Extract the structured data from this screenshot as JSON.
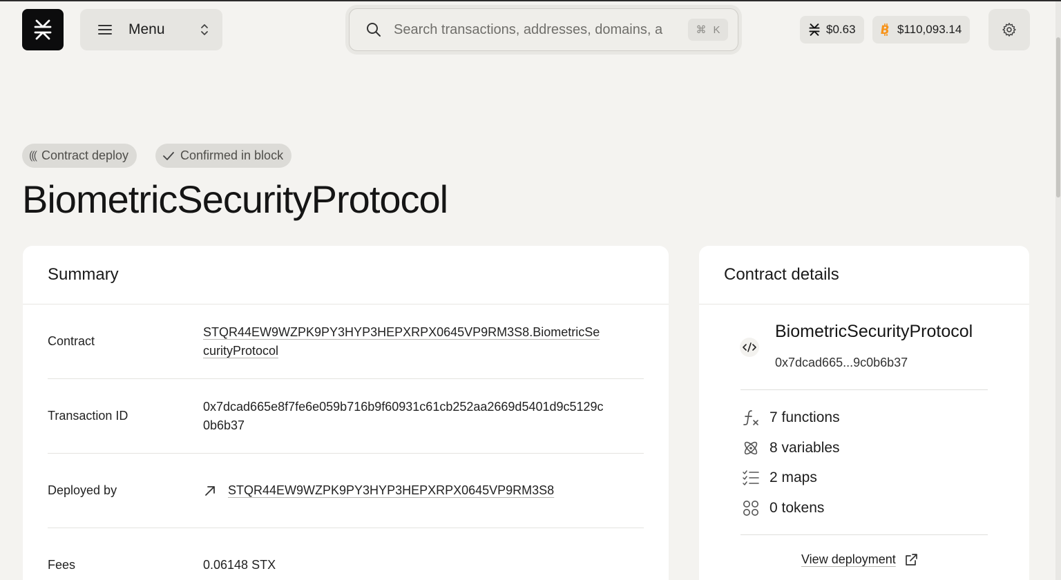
{
  "header": {
    "menu_label": "Menu",
    "search": {
      "placeholder": "Search transactions, addresses, domains, a",
      "shortcut_symbol": "⌘",
      "shortcut_key": "K"
    },
    "prices": {
      "stx": "$0.63",
      "btc": "$110,093.14"
    },
    "icons": [
      "stacks-logo-icon",
      "hamburger-icon",
      "chevron-updown-icon",
      "search-icon",
      "bitcoin-icon",
      "gear-icon"
    ]
  },
  "badges": {
    "type": "Contract deploy",
    "status": "Confirmed in block"
  },
  "page_title": "BiometricSecurityProtocol",
  "summary": {
    "title": "Summary",
    "rows": [
      {
        "key": "Contract",
        "value": "STQR44EW9WZPK9PY3HYP3HEPXRPX0645VP9RM3S8.BiometricSecurityProtocol"
      },
      {
        "key": "Transaction ID",
        "value": "0x7dcad665e8f7fe6e059b716b9f60931c61cb252aa2669d5401d9c5129c0b6b37"
      },
      {
        "key": "Deployed by",
        "value": "STQR44EW9WZPK9PY3HYP3HEPXRPX0645VP9RM3S8"
      },
      {
        "key": "Fees",
        "value": "0.06148 STX"
      }
    ]
  },
  "contract_details": {
    "title": "Contract details",
    "name": "BiometricSecurityProtocol",
    "hash": "0x7dcad665...9c0b6b37",
    "stats": {
      "functions": "7 functions",
      "variables": "8 variables",
      "maps": "2 maps",
      "tokens": "0 tokens"
    },
    "view_deployment": "View deployment"
  },
  "colors": {
    "background": "#f4f3f0",
    "card": "#ffffff",
    "chip": "#e6e5e1",
    "bitcoin_orange": "#f7931a"
  }
}
